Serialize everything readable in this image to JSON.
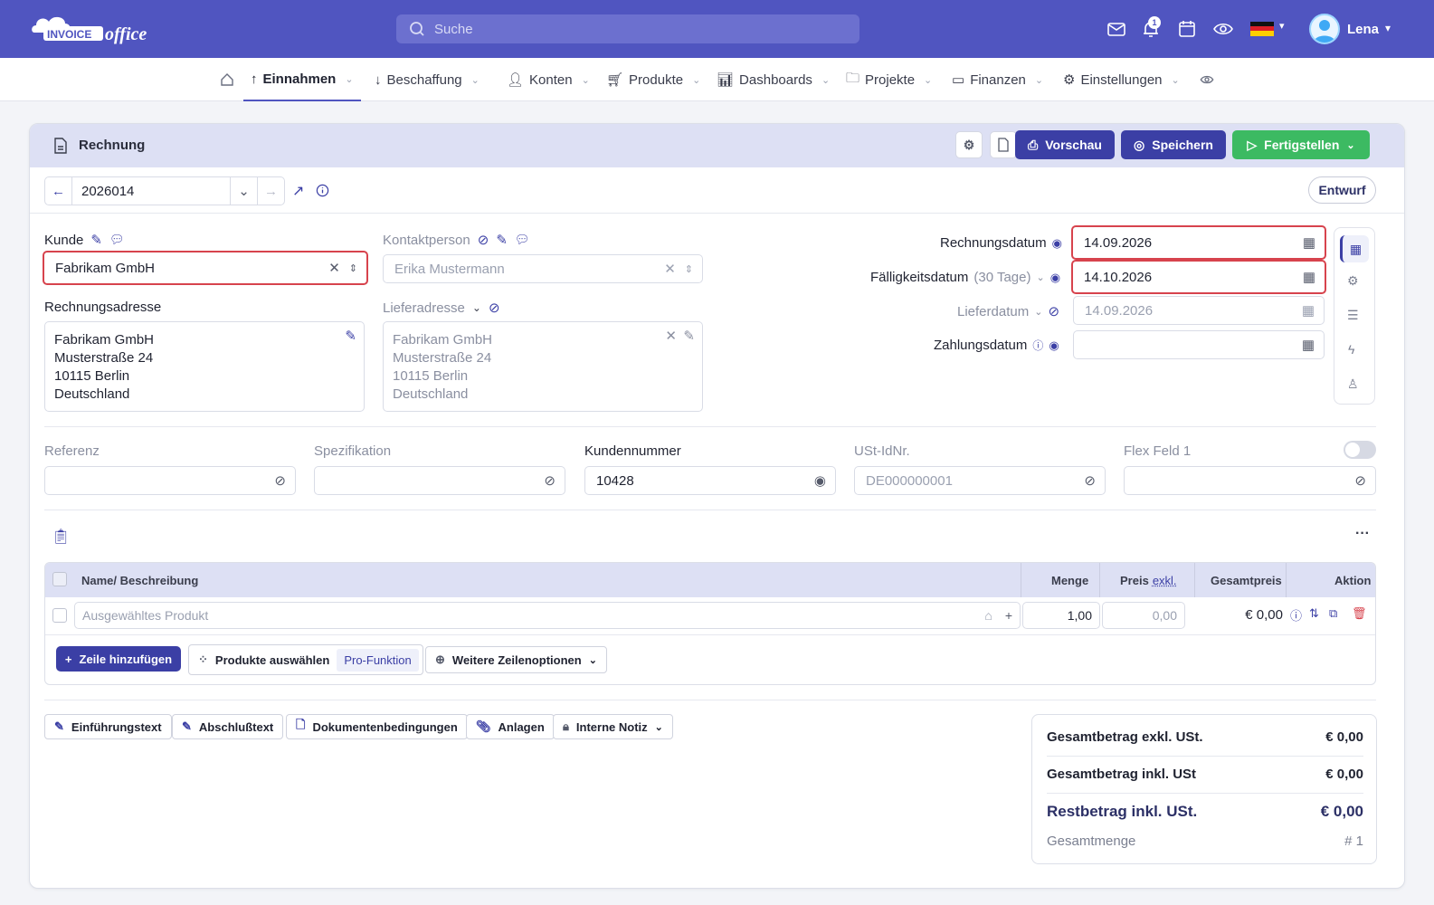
{
  "header": {
    "logo_text": "INVOICE office",
    "search_placeholder": "Suche",
    "notification_count": "1",
    "user_name": "Lena"
  },
  "nav": {
    "items": [
      {
        "label": "Einnahmen"
      },
      {
        "label": "Beschaffung"
      },
      {
        "label": "Konten"
      },
      {
        "label": "Produkte"
      },
      {
        "label": "Dashboards"
      },
      {
        "label": "Projekte"
      },
      {
        "label": "Finanzen"
      },
      {
        "label": "Einstellungen"
      }
    ]
  },
  "document": {
    "title": "Rechnung",
    "preview_label": "Vorschau",
    "save_label": "Speichern",
    "finish_label": "Fertigstellen",
    "number": "2026014",
    "status": "Entwurf"
  },
  "customer": {
    "label": "Kunde",
    "value": "Fabrikam GmbH",
    "contact_label": "Kontaktperson",
    "contact_value": "Erika Mustermann",
    "billing_label": "Rechnungsadresse",
    "billing_lines": [
      "Fabrikam GmbH",
      "Musterstraße 24",
      "10115 Berlin",
      "Deutschland"
    ],
    "delivery_label": "Lieferadresse",
    "delivery_lines": [
      "Fabrikam GmbH",
      "Musterstraße 24",
      "10115 Berlin",
      "Deutschland"
    ]
  },
  "dates": {
    "invoice_date_label": "Rechnungsdatum",
    "invoice_date": "14.09.2026",
    "due_date_label": "Fälligkeitsdatum",
    "due_hint": "(30 Tage)",
    "due_date": "14.10.2026",
    "delivery_date_label": "Lieferdatum",
    "delivery_date": "14.09.2026",
    "payment_date_label": "Zahlungsdatum",
    "payment_date": ""
  },
  "fields": {
    "reference_label": "Referenz",
    "specification_label": "Spezifikation",
    "customer_number_label": "Kundennummer",
    "customer_number": "10428",
    "vat_id_label": "USt-IdNr.",
    "vat_id_placeholder": "DE000000001",
    "flex_label": "Flex Feld 1"
  },
  "table": {
    "headers": {
      "name": "Name/ Beschreibung",
      "quantity": "Menge",
      "price": "Preis",
      "price_suffix": "exkl.",
      "total": "Gesamtpreis",
      "action": "Aktion"
    },
    "row": {
      "product_placeholder": "Ausgewähltes Produkt",
      "quantity": "1,00",
      "price_placeholder": "0,00",
      "total": "€ 0,00"
    },
    "add_row_label": "Zeile hinzufügen",
    "select_products_label": "Produkte auswählen",
    "pro_badge": "Pro-Funktion",
    "more_options_label": "Weitere Zeilenoptionen"
  },
  "footer_buttons": {
    "intro": "Einführungstext",
    "closing": "Abschlußtext",
    "conditions": "Dokumentenbedingungen",
    "attachments": "Anlagen",
    "internal_note": "Interne Notiz"
  },
  "totals": {
    "net_label": "Gesamtbetrag exkl. USt.",
    "net_value": "€ 0,00",
    "gross_label": "Gesamtbetrag inkl. USt",
    "gross_value": "€ 0,00",
    "remaining_label": "Restbetrag inkl. USt.",
    "remaining_value": "€ 0,00",
    "quantity_label": "Gesamtmenge",
    "quantity_value": "# 1"
  }
}
